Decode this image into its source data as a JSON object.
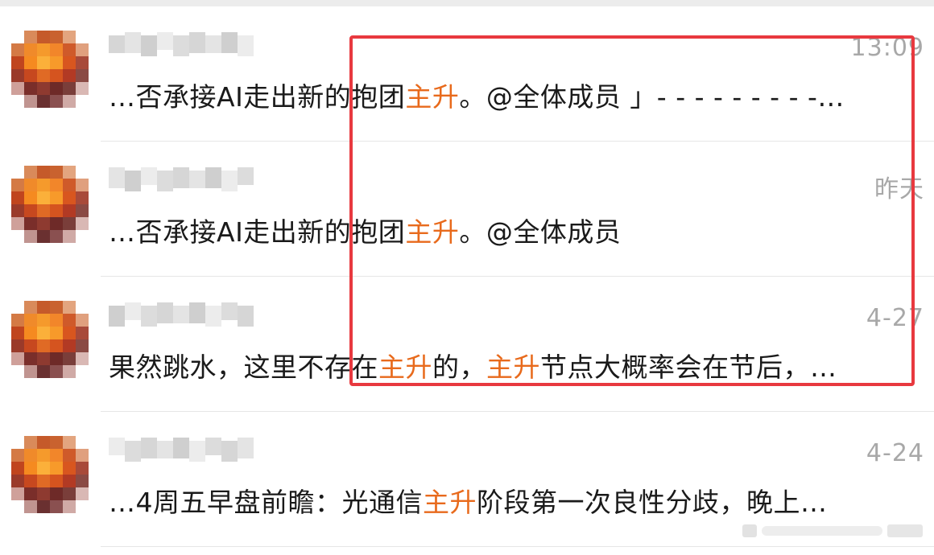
{
  "colors": {
    "highlight": "#e86a1c",
    "annotation_box": "#e8393f",
    "timestamp": "#a8a8a8",
    "text": "#1a1a1a"
  },
  "conversations": [
    {
      "time": "13:09",
      "preview": [
        {
          "text": "…否承接AI走出新的抱团"
        },
        {
          "text": "主升",
          "highlight": true
        },
        {
          "text": "。@全体成员 」- - - - - - - - -…"
        }
      ]
    },
    {
      "time": "昨天",
      "preview": [
        {
          "text": "…否承接AI走出新的抱团"
        },
        {
          "text": "主升",
          "highlight": true
        },
        {
          "text": "。@全体成员"
        }
      ]
    },
    {
      "time": "4-27",
      "preview": [
        {
          "text": "果然跳水，这里不存在"
        },
        {
          "text": "主升",
          "highlight": true
        },
        {
          "text": "的，"
        },
        {
          "text": "主升",
          "highlight": true
        },
        {
          "text": "节点大概率会在节后，…"
        }
      ]
    },
    {
      "time": "4-24",
      "preview": [
        {
          "text": "…4周五早盘前瞻：光通信"
        },
        {
          "text": "主升",
          "highlight": true
        },
        {
          "text": "阶段第一次良性分歧，晚上…"
        }
      ]
    }
  ]
}
